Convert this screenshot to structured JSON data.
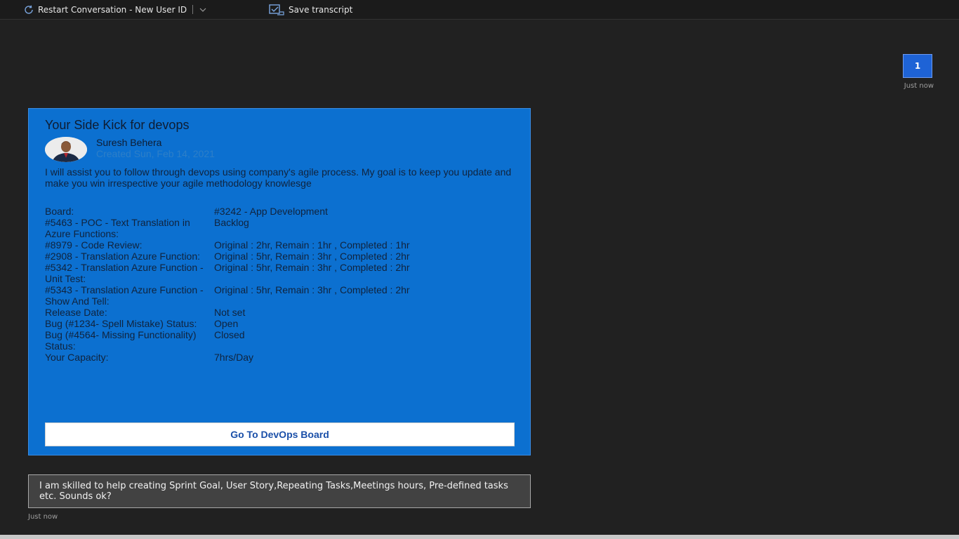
{
  "toolbar": {
    "restart_label": "Restart Conversation - New User ID",
    "save_label": "Save transcript"
  },
  "user_message": {
    "text": "1",
    "timestamp": "Just now"
  },
  "card": {
    "title": "Your Side Kick for devops",
    "author": "Suresh Behera",
    "created": "Created Sun, Feb 14, 2021",
    "description": "I will assist you to follow through devops using company's agile process. My goal is to keep you update and make you win irrespective your agile methodology knowlesge",
    "facts": [
      {
        "key": "Board:",
        "value": "#3242 - App Development"
      },
      {
        "key": "#5463 - POC - Text Translation in Azure Functions:",
        "value": "Backlog"
      },
      {
        "key": "#8979 - Code Review:",
        "value": "Original : 2hr, Remain : 1hr , Completed : 1hr"
      },
      {
        "key": "#2908 - Translation Azure Function:",
        "value": "Original : 5hr, Remain : 3hr , Completed : 2hr"
      },
      {
        "key": "#5342 - Translation Azure Function - Unit Test:",
        "value": "Original : 5hr, Remain : 3hr , Completed : 2hr"
      },
      {
        "key": "#5343 - Translation Azure Function - Show And Tell:",
        "value": "Original : 5hr, Remain : 3hr , Completed : 2hr"
      },
      {
        "key": "Release Date:",
        "value": "Not set"
      },
      {
        "key": "Bug (#1234- Spell Mistake) Status:",
        "value": "Open"
      },
      {
        "key": "Bug (#4564- Missing Functionality) Status:",
        "value": "Closed"
      },
      {
        "key": "Your Capacity:",
        "value": "7hrs/Day"
      }
    ],
    "action_label": "Go To DevOps Board"
  },
  "bot_message": {
    "text": "I am skilled to help creating Sprint Goal, User Story,Repeating Tasks,Meetings hours, Pre-defined tasks etc. Sounds ok?",
    "timestamp": "Just now"
  }
}
